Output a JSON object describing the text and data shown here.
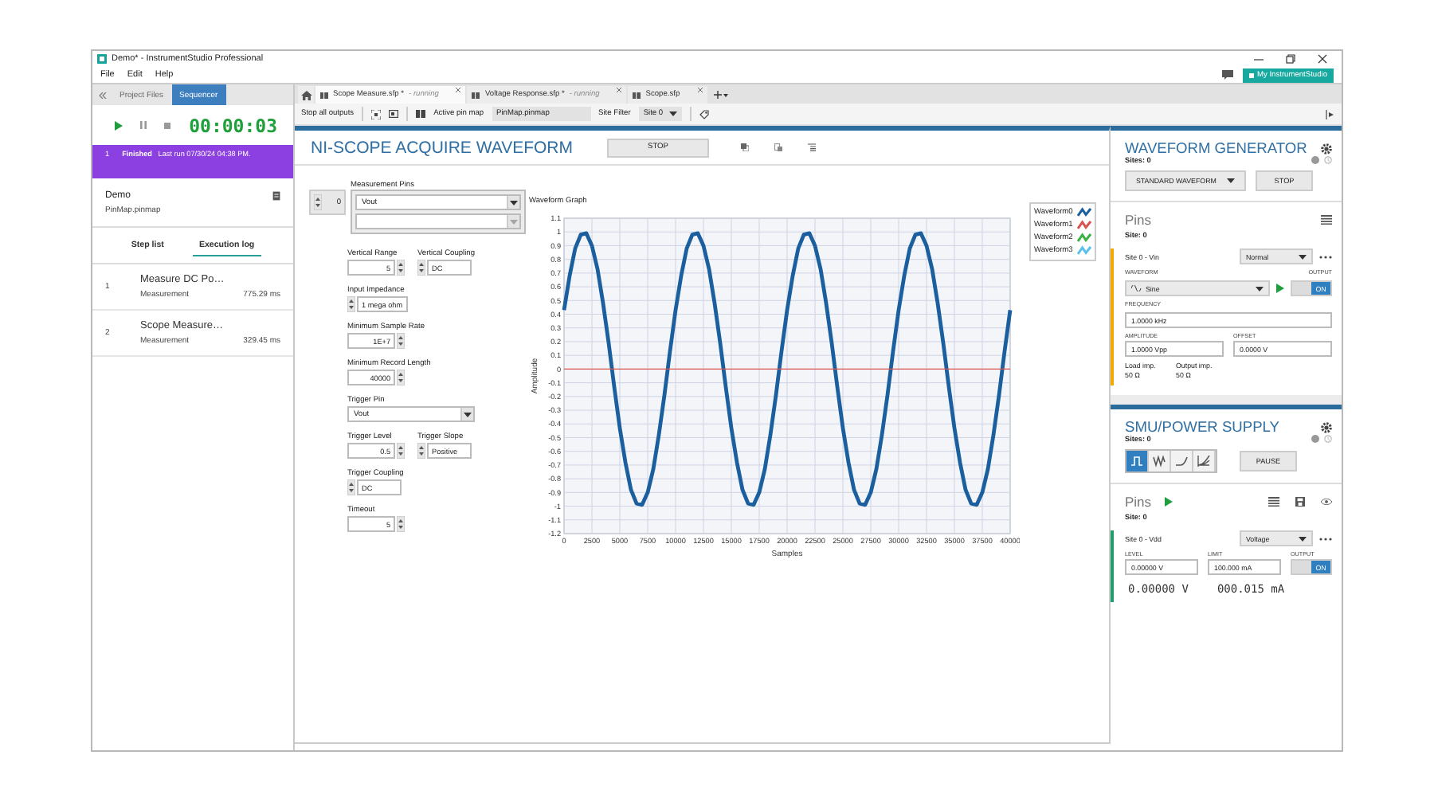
{
  "window": {
    "title": "Demo* - InstrumentStudio Professional"
  },
  "menu": [
    {
      "label": "File"
    },
    {
      "label": "Edit"
    },
    {
      "label": "Help"
    }
  ],
  "account_button": {
    "label": "My InstrumentStudio"
  },
  "left_panel": {
    "tabs": [
      {
        "label": "Project Files",
        "selected": false
      },
      {
        "label": "Sequencer",
        "selected": true
      }
    ],
    "timer": "00:00:03",
    "run_status": {
      "index": "1",
      "status": "Finished",
      "detail": "Last run 07/30/24 04:38 PM."
    },
    "project": {
      "name": "Demo",
      "pin_map": "PinMap.pinmap"
    },
    "view_tabs": [
      {
        "label": "Step list",
        "selected": false
      },
      {
        "label": "Execution log",
        "selected": true
      }
    ],
    "execution_log": [
      {
        "index": "1",
        "name": "Measure DC Po…",
        "type": "Measurement",
        "duration": "775.29 ms"
      },
      {
        "index": "2",
        "name": "Scope Measure…",
        "type": "Measurement",
        "duration": "329.45 ms"
      }
    ]
  },
  "document_tabs": [
    {
      "label": "Scope Measure.sfp *",
      "status": "- running",
      "selected": true
    },
    {
      "label": "Voltage Response.sfp *",
      "status": "- running",
      "selected": false
    },
    {
      "label": "Scope.sfp",
      "selected": false
    }
  ],
  "toolbar": {
    "stop_all": "Stop all outputs",
    "pin_map_label": "Active pin map",
    "pin_map": "PinMap.pinmap",
    "site_filter_label": "Site Filter",
    "site_filter": "Site 0"
  },
  "scope_panel": {
    "title": "NI-SCOPE ACQUIRE WAVEFORM",
    "stop_button": "STOP",
    "measurement_pins": {
      "label": "Measurement Pins",
      "index": "0",
      "value": "Vout"
    },
    "rows": [
      [
        {
          "kind": "numeric",
          "label": "Vertical Range",
          "value": "5"
        },
        {
          "kind": "ring",
          "label": "Vertical Coupling",
          "value": "DC"
        }
      ],
      [
        {
          "kind": "ring",
          "label": "Input Impedance",
          "value": "1 mega ohm"
        }
      ],
      [
        {
          "kind": "numeric",
          "label": "Minimum Sample Rate",
          "value": "1E+7"
        }
      ],
      [
        {
          "kind": "numeric",
          "label": "Minimum Record Length",
          "value": "40000"
        }
      ],
      [
        {
          "kind": "dropdown",
          "label": "Trigger Pin",
          "value": "Vout"
        }
      ],
      [
        {
          "kind": "numeric",
          "label": "Trigger Level",
          "value": "0.5"
        },
        {
          "kind": "ring",
          "label": "Trigger Slope",
          "value": "Positive"
        }
      ],
      [
        {
          "kind": "ring",
          "label": "Trigger Coupling",
          "value": "DC"
        }
      ],
      [
        {
          "kind": "numeric",
          "label": "Timeout",
          "value": "5"
        }
      ]
    ],
    "graph": {
      "title": "Waveform Graph",
      "chart_data": {
        "type": "line",
        "grid": true,
        "xlabel": "Samples",
        "ylabel": "Amplitude",
        "xlim": [
          0,
          40000
        ],
        "ylim": [
          -1.2,
          1.1
        ],
        "xticks": [
          0,
          2500,
          5000,
          7500,
          10000,
          12500,
          15000,
          17500,
          20000,
          22500,
          25000,
          27500,
          30000,
          32500,
          35000,
          37500,
          40000
        ],
        "yticks": [
          1.1,
          1,
          0.9,
          0.8,
          0.7,
          0.6,
          0.5,
          0.4,
          0.3,
          0.2,
          0.1,
          0,
          -0.1,
          -0.2,
          -0.3,
          -0.4,
          -0.5,
          -0.6,
          -0.7,
          -0.8,
          -0.9,
          -1,
          -1.1,
          -1.2
        ],
        "x": [
          0,
          500,
          1000,
          1500,
          2000,
          2500,
          3000,
          3500,
          4000,
          4500,
          5000,
          5500,
          6000,
          6500,
          7000,
          7500,
          8000,
          8500,
          9000,
          9500,
          10000,
          10500,
          11000,
          11500,
          12000,
          12500,
          13000,
          13500,
          14000,
          14500,
          15000,
          15500,
          16000,
          16500,
          17000,
          17500,
          18000,
          18500,
          19000,
          19500,
          20000,
          20500,
          21000,
          21500,
          22000,
          22500,
          23000,
          23500,
          24000,
          24500,
          25000,
          25500,
          26000,
          26500,
          27000,
          27500,
          28000,
          28500,
          29000,
          29500,
          30000,
          30500,
          31000,
          31500,
          32000,
          32500,
          33000,
          33500,
          34000,
          34500,
          35000,
          35500,
          36000,
          36500,
          37000,
          37500,
          38000,
          38500,
          39000,
          39500,
          40000
        ],
        "series": [
          {
            "name": "Waveform0",
            "color": "#1b5f9e",
            "values": [
              0.43,
              0.68,
              0.88,
              0.98,
              0.99,
              0.9,
              0.73,
              0.48,
              0.19,
              -0.13,
              -0.43,
              -0.68,
              -0.88,
              -0.98,
              -0.99,
              -0.9,
              -0.73,
              -0.48,
              -0.19,
              0.13,
              0.43,
              0.68,
              0.88,
              0.98,
              0.99,
              0.9,
              0.73,
              0.48,
              0.19,
              -0.13,
              -0.43,
              -0.68,
              -0.88,
              -0.98,
              -0.99,
              -0.9,
              -0.73,
              -0.48,
              -0.19,
              0.13,
              0.43,
              0.68,
              0.88,
              0.98,
              0.99,
              0.9,
              0.73,
              0.48,
              0.19,
              -0.13,
              -0.43,
              -0.68,
              -0.88,
              -0.98,
              -0.99,
              -0.9,
              -0.73,
              -0.48,
              -0.19,
              0.13,
              0.43,
              0.68,
              0.88,
              0.98,
              0.99,
              0.9,
              0.73,
              0.48,
              0.19,
              -0.13,
              -0.43,
              -0.68,
              -0.88,
              -0.98,
              -0.99,
              -0.9,
              -0.73,
              -0.48,
              -0.19,
              0.13,
              0.43
            ]
          },
          {
            "name": "Waveform1",
            "color": "#d9534f",
            "values": [
              0,
              0,
              0,
              0,
              0,
              0,
              0,
              0,
              0,
              0,
              0,
              0,
              0,
              0,
              0,
              0,
              0,
              0,
              0,
              0,
              0,
              0,
              0,
              0,
              0,
              0,
              0,
              0,
              0,
              0,
              0,
              0,
              0,
              0,
              0,
              0,
              0,
              0,
              0,
              0,
              0,
              0,
              0,
              0,
              0,
              0,
              0,
              0,
              0,
              0,
              0,
              0,
              0,
              0,
              0,
              0,
              0,
              0,
              0,
              0,
              0,
              0,
              0,
              0,
              0,
              0,
              0,
              0,
              0,
              0,
              0,
              0,
              0,
              0,
              0,
              0,
              0,
              0,
              0,
              0,
              0
            ]
          },
          {
            "name": "Waveform2",
            "color": "#3cb043",
            "values": [
              null,
              null,
              null,
              null,
              null,
              null,
              null,
              null,
              null,
              null,
              null,
              null,
              null,
              null,
              null,
              null,
              null,
              null,
              null,
              null,
              null,
              null,
              null,
              null,
              null,
              null,
              null,
              null,
              null,
              null,
              null,
              null,
              null,
              null,
              null,
              null,
              null,
              null,
              null,
              null,
              null,
              null,
              null,
              null,
              null,
              null,
              null,
              null,
              null,
              null,
              null,
              null,
              null,
              null,
              null,
              null,
              null,
              null,
              null,
              null,
              null,
              null,
              null,
              null,
              null,
              null,
              null,
              null,
              null,
              null,
              null,
              null,
              null,
              null,
              null,
              null,
              null,
              null,
              null,
              null,
              null
            ]
          },
          {
            "name": "Waveform3",
            "color": "#5bc0eb",
            "values": [
              null,
              null,
              null,
              null,
              null,
              null,
              null,
              null,
              null,
              null,
              null,
              null,
              null,
              null,
              null,
              null,
              null,
              null,
              null,
              null,
              null,
              null,
              null,
              null,
              null,
              null,
              null,
              null,
              null,
              null,
              null,
              null,
              null,
              null,
              null,
              null,
              null,
              null,
              null,
              null,
              null,
              null,
              null,
              null,
              null,
              null,
              null,
              null,
              null,
              null,
              null,
              null,
              null,
              null,
              null,
              null,
              null,
              null,
              null,
              null,
              null,
              null,
              null,
              null,
              null,
              null,
              null,
              null,
              null,
              null,
              null,
              null,
              null,
              null,
              null,
              null,
              null,
              null,
              null,
              null,
              null
            ]
          }
        ]
      }
    }
  },
  "waveform_generator": {
    "title": "WAVEFORM GENERATOR",
    "sites": "Sites: 0",
    "mode": "STANDARD WAVEFORM",
    "stop_button": "STOP",
    "pins": {
      "title": "Pins",
      "site": "Site: 0",
      "channel": "Site 0 - Vin",
      "channel_mode": "Normal",
      "waveform_label": "WAVEFORM",
      "waveform": "Sine",
      "output_label": "OUTPUT",
      "output": {
        "label": "ON",
        "on": true
      },
      "frequency_label": "FREQUENCY",
      "frequency": "1.0000 kHz",
      "amplitude_label": "AMPLITUDE",
      "amplitude": "1.0000 Vpp",
      "offset_label": "OFFSET",
      "offset": "0.0000 V",
      "load_label": "Load imp.",
      "load": "50 Ω",
      "output_imp_label": "Output imp.",
      "output_imp": "50 Ω"
    }
  },
  "smu": {
    "title": "SMU/POWER SUPPLY",
    "sites": "Sites: 0",
    "modes": [
      {
        "kind": "pulse",
        "selected": true
      },
      {
        "kind": "sweep",
        "selected": false
      },
      {
        "kind": "curve",
        "selected": false
      },
      {
        "kind": "fan",
        "selected": false
      }
    ],
    "pause_button": "PAUSE",
    "pins": {
      "title": "Pins",
      "site": "Site: 0",
      "channel": "Site 0 - Vdd",
      "channel_mode": "Voltage",
      "level_label": "LEVEL",
      "level": "0.00000 V",
      "limit_label": "LIMIT",
      "limit": "100.000 mA",
      "output_label": "OUTPUT",
      "output": {
        "label": "ON",
        "on": true
      },
      "voltage_reading": "0.00000 V",
      "current_reading": "000.015 mA"
    }
  }
}
